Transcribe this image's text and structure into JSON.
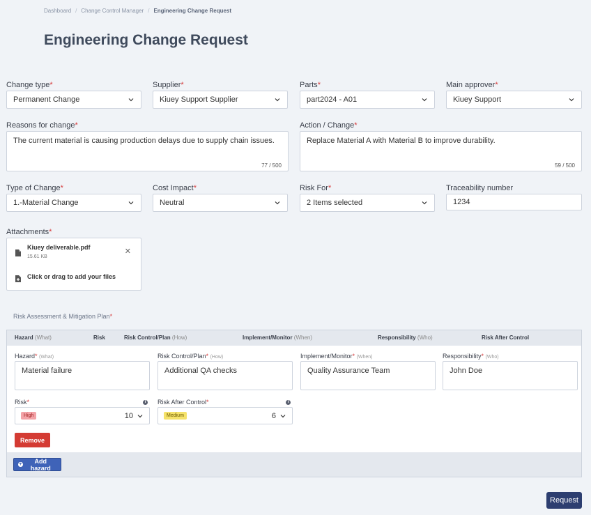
{
  "breadcrumb": {
    "items": [
      "Dashboard",
      "Change Control Manager",
      "Engineering Change Request"
    ]
  },
  "page_title": "Engineering Change Request",
  "form": {
    "change_type": {
      "label": "Change type",
      "value": "Permanent Change"
    },
    "supplier": {
      "label": "Supplier",
      "value": "Kiuey Support Supplier"
    },
    "parts": {
      "label": "Parts",
      "value": "part2024 - A01"
    },
    "main_approver": {
      "label": "Main approver",
      "value": "Kiuey Support"
    },
    "reasons": {
      "label": "Reasons for change",
      "value": "The current material is causing production delays due to supply chain issues.",
      "counter": "77 / 500"
    },
    "action": {
      "label": "Action / Change",
      "value": "Replace Material A with Material B to improve durability.",
      "counter": "59 / 500"
    },
    "type_of_change": {
      "label": "Type of Change",
      "value": "1.-Material Change"
    },
    "cost_impact": {
      "label": "Cost Impact",
      "value": "Neutral"
    },
    "risk_for": {
      "label": "Risk For",
      "value": "2 Items selected"
    },
    "traceability": {
      "label": "Traceability number",
      "value": "1234"
    }
  },
  "attachments": {
    "label": "Attachments",
    "file_name": "Kiuey deliverable.pdf",
    "file_size": "15.61 KB",
    "add_text": "Click or drag to add your files"
  },
  "risk_section": {
    "title": "Risk Assessment & Mitigation Plan",
    "headers": {
      "hazard": "Hazard",
      "hazard_sub": "(What)",
      "risk": "Risk",
      "control": "Risk Control/Plan",
      "control_sub": "(How)",
      "implement": "Implement/Monitor",
      "implement_sub": "(When)",
      "responsibility": "Responsibility",
      "responsibility_sub": "(Who)",
      "after": "Risk After Control"
    },
    "row": {
      "hazard_label": "Hazard",
      "hazard_sub": "(What)",
      "hazard_value": "Material failure",
      "control_label": "Risk Control/Plan",
      "control_sub": "(How)",
      "control_value": "Additional QA checks",
      "implement_label": "Implement/Monitor",
      "implement_sub": "(When)",
      "implement_value": "Quality Assurance Team",
      "responsibility_label": "Responsibility",
      "responsibility_sub": "(Who)",
      "responsibility_value": "John Doe",
      "risk_label": "Risk",
      "risk_badge": "High",
      "risk_value": "10",
      "after_label": "Risk After Control",
      "after_badge": "Medium",
      "after_value": "6"
    },
    "remove_label": "Remove",
    "add_hazard_label": "Add hazard"
  },
  "request_label": "Request",
  "colors": {
    "primary": "#2d3e70",
    "danger": "#d43b33",
    "accent": "#3f63b8",
    "required": "#d63a3a"
  }
}
